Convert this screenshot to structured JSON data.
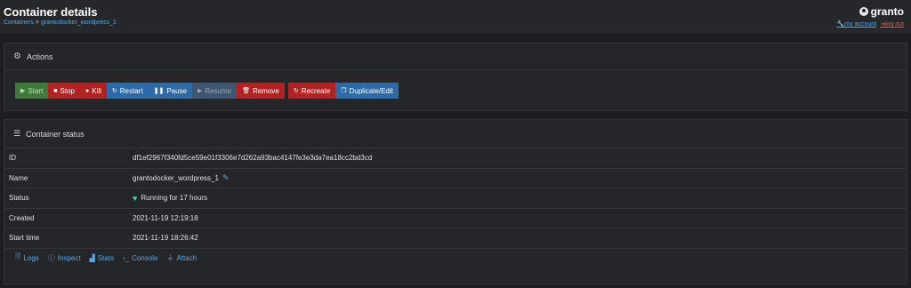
{
  "header": {
    "title": "Container details",
    "breadcrumb": {
      "root": "Containers",
      "separator": ">",
      "current": "grantodocker_wordpress_1"
    },
    "user": {
      "name": "granto",
      "my_account": "my account",
      "log_out": "log out"
    }
  },
  "actions": {
    "title": "Actions",
    "buttons": {
      "start": "Start",
      "stop": "Stop",
      "kill": "Kill",
      "restart": "Restart",
      "pause": "Pause",
      "resume": "Resume",
      "remove": "Remove",
      "recreate": "Recreate",
      "duplicate": "Duplicate/Edit"
    }
  },
  "status": {
    "title": "Container status",
    "rows": {
      "id": {
        "label": "ID",
        "value": "df1ef2967f340fd5ce59e01f3306e7d262a93bac4147fe3e3da7ea18cc2bd3cd"
      },
      "name": {
        "label": "Name",
        "value": "grantodocker_wordpress_1"
      },
      "status": {
        "label": "Status",
        "value": "Running for 17 hours"
      },
      "created": {
        "label": "Created",
        "value": "2021-11-19 12:19:18"
      },
      "start_time": {
        "label": "Start time",
        "value": "2021-11-19 18:26:42"
      }
    },
    "links": {
      "logs": "Logs",
      "inspect": "Inspect",
      "stats": "Stats",
      "console": "Console",
      "attach": "Attach"
    }
  },
  "colors": {
    "background": "#1e1e21",
    "accent": "#5aa6e0",
    "danger": "#b22222",
    "primary": "#2d6aa8",
    "success": "#3f7a3a"
  }
}
